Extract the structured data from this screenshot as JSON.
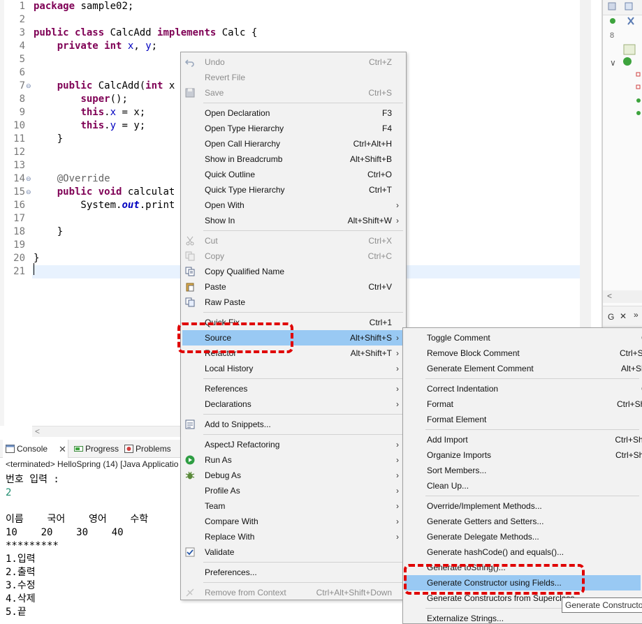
{
  "editor": {
    "line_numbers": [
      "1",
      "2",
      "3",
      "4",
      "5",
      "6",
      "7",
      "8",
      "9",
      "10",
      "11",
      "12",
      "13",
      "14",
      "15",
      "16",
      "17",
      "18",
      "19",
      "20",
      "21"
    ],
    "lines": [
      [
        {
          "t": "package",
          "c": "kw"
        },
        {
          "t": " sample02;"
        }
      ],
      [],
      [
        {
          "t": "public",
          "c": "kw"
        },
        {
          "t": " "
        },
        {
          "t": "class",
          "c": "kw"
        },
        {
          "t": " CalcAdd "
        },
        {
          "t": "implements",
          "c": "kw"
        },
        {
          "t": " Calc {"
        }
      ],
      [
        {
          "t": "    "
        },
        {
          "t": "private",
          "c": "kw"
        },
        {
          "t": " "
        },
        {
          "t": "int",
          "c": "kw"
        },
        {
          "t": " "
        },
        {
          "t": "x",
          "c": "fld"
        },
        {
          "t": ", "
        },
        {
          "t": "y",
          "c": "fld"
        },
        {
          "t": ";"
        }
      ],
      [],
      [],
      [
        {
          "t": "    "
        },
        {
          "t": "public",
          "c": "kw"
        },
        {
          "t": " CalcAdd("
        },
        {
          "t": "int",
          "c": "kw"
        },
        {
          "t": " x"
        }
      ],
      [
        {
          "t": "        "
        },
        {
          "t": "super",
          "c": "kw"
        },
        {
          "t": "();"
        }
      ],
      [
        {
          "t": "        "
        },
        {
          "t": "this",
          "c": "kw"
        },
        {
          "t": "."
        },
        {
          "t": "x",
          "c": "fld"
        },
        {
          "t": " = x;"
        }
      ],
      [
        {
          "t": "        "
        },
        {
          "t": "this",
          "c": "kw"
        },
        {
          "t": "."
        },
        {
          "t": "y",
          "c": "fld"
        },
        {
          "t": " = y;"
        }
      ],
      [
        {
          "t": "    }"
        }
      ],
      [],
      [],
      [
        {
          "t": "    "
        },
        {
          "t": "@Override",
          "c": "ann"
        }
      ],
      [
        {
          "t": "    "
        },
        {
          "t": "public",
          "c": "kw"
        },
        {
          "t": " "
        },
        {
          "t": "void",
          "c": "kw"
        },
        {
          "t": " calculat"
        }
      ],
      [
        {
          "t": "        System."
        },
        {
          "t": "out",
          "c": "ital"
        },
        {
          "t": ".print"
        }
      ],
      [],
      [
        {
          "t": "    }"
        }
      ],
      [],
      [
        {
          "t": "}"
        }
      ],
      []
    ]
  },
  "console": {
    "tabs": [
      {
        "label": "Console",
        "icon": "console-icon"
      },
      {
        "label": "Progress",
        "icon": "progress-icon"
      },
      {
        "label": "Problems",
        "icon": "problems-icon"
      }
    ],
    "close_glyph": "✕",
    "terminated": "<terminated> HelloSpring (14) [Java Applicatio",
    "output": [
      {
        "text": "번호 입력 :",
        "c": ""
      },
      {
        "text": "2",
        "c": "green"
      },
      {
        "text": "",
        "c": ""
      },
      {
        "text": "이름    국어    영어    수학",
        "c": ""
      },
      {
        "text": "10    20    30    40",
        "c": ""
      },
      {
        "text": "*********",
        "c": ""
      },
      {
        "text": "1.입력",
        "c": ""
      },
      {
        "text": "2.출력",
        "c": ""
      },
      {
        "text": "3.수정",
        "c": ""
      },
      {
        "text": "4.삭제",
        "c": ""
      },
      {
        "text": "5.끝",
        "c": ""
      }
    ]
  },
  "right_panel": {
    "tab_label": "G",
    "close_glyph": "✕",
    "more_glyph": "»",
    "scroll_left": "<"
  },
  "menu": {
    "items": [
      {
        "label": "Undo",
        "shortcut": "Ctrl+Z",
        "disabled": true,
        "icon": "undo-icon",
        "name": "undo"
      },
      {
        "label": "Revert File",
        "shortcut": "",
        "disabled": true,
        "name": "revert-file"
      },
      {
        "label": "Save",
        "shortcut": "Ctrl+S",
        "disabled": true,
        "icon": "save-icon",
        "name": "save"
      },
      {
        "sep": true
      },
      {
        "label": "Open Declaration",
        "shortcut": "F3",
        "name": "open-declaration"
      },
      {
        "label": "Open Type Hierarchy",
        "shortcut": "F4",
        "name": "open-type-hierarchy"
      },
      {
        "label": "Open Call Hierarchy",
        "shortcut": "Ctrl+Alt+H",
        "name": "open-call-hierarchy"
      },
      {
        "label": "Show in Breadcrumb",
        "shortcut": "Alt+Shift+B",
        "name": "show-in-breadcrumb"
      },
      {
        "label": "Quick Outline",
        "shortcut": "Ctrl+O",
        "name": "quick-outline"
      },
      {
        "label": "Quick Type Hierarchy",
        "shortcut": "Ctrl+T",
        "name": "quick-type-hierarchy"
      },
      {
        "label": "Open With",
        "shortcut": "",
        "submenu": true,
        "name": "open-with"
      },
      {
        "label": "Show In",
        "shortcut": "Alt+Shift+W",
        "submenu": true,
        "name": "show-in"
      },
      {
        "sep": true
      },
      {
        "label": "Cut",
        "shortcut": "Ctrl+X",
        "disabled": true,
        "icon": "cut-icon",
        "name": "cut"
      },
      {
        "label": "Copy",
        "shortcut": "Ctrl+C",
        "disabled": true,
        "icon": "copy-icon",
        "name": "copy"
      },
      {
        "label": "Copy Qualified Name",
        "shortcut": "",
        "icon": "copy-qualified-icon",
        "name": "copy-qualified-name"
      },
      {
        "label": "Paste",
        "shortcut": "Ctrl+V",
        "icon": "paste-icon",
        "name": "paste"
      },
      {
        "label": "Raw Paste",
        "shortcut": "",
        "icon": "raw-paste-icon",
        "name": "raw-paste"
      },
      {
        "sep": true
      },
      {
        "label": "Quick Fix",
        "shortcut": "Ctrl+1",
        "name": "quick-fix"
      },
      {
        "label": "Source",
        "shortcut": "Alt+Shift+S",
        "submenu": true,
        "highlight": true,
        "name": "source"
      },
      {
        "label": "Refactor",
        "shortcut": "Alt+Shift+T",
        "submenu": true,
        "name": "refactor"
      },
      {
        "label": "Local History",
        "shortcut": "",
        "submenu": true,
        "name": "local-history"
      },
      {
        "sep": true
      },
      {
        "label": "References",
        "shortcut": "",
        "submenu": true,
        "name": "references"
      },
      {
        "label": "Declarations",
        "shortcut": "",
        "submenu": true,
        "name": "declarations"
      },
      {
        "sep": true
      },
      {
        "label": "Add to Snippets...",
        "shortcut": "",
        "icon": "snippets-icon",
        "name": "add-to-snippets"
      },
      {
        "sep": true
      },
      {
        "label": "AspectJ Refactoring",
        "shortcut": "",
        "submenu": true,
        "name": "aspectj-refactoring"
      },
      {
        "label": "Run As",
        "shortcut": "",
        "submenu": true,
        "icon": "run-icon",
        "name": "run-as"
      },
      {
        "label": "Debug As",
        "shortcut": "",
        "submenu": true,
        "icon": "debug-icon",
        "name": "debug-as"
      },
      {
        "label": "Profile As",
        "shortcut": "",
        "submenu": true,
        "name": "profile-as"
      },
      {
        "label": "Team",
        "shortcut": "",
        "submenu": true,
        "name": "team"
      },
      {
        "label": "Compare With",
        "shortcut": "",
        "submenu": true,
        "name": "compare-with"
      },
      {
        "label": "Replace With",
        "shortcut": "",
        "submenu": true,
        "name": "replace-with"
      },
      {
        "label": "Validate",
        "shortcut": "",
        "icon": "checkbox-checked-icon",
        "name": "validate"
      },
      {
        "sep": true
      },
      {
        "label": "Preferences...",
        "shortcut": "",
        "name": "preferences"
      },
      {
        "sep": true
      },
      {
        "label": "Remove from Context",
        "shortcut": "Ctrl+Alt+Shift+Down",
        "disabled": true,
        "icon": "remove-context-icon",
        "name": "remove-from-context"
      }
    ],
    "submenu_arrow": "›"
  },
  "submenu": {
    "items": [
      {
        "label": "Toggle Comment",
        "shortcut": "Ctrl+/",
        "name": "toggle-comment"
      },
      {
        "label": "Remove Block Comment",
        "shortcut": "Ctrl+Shift+\\",
        "name": "remove-block-comment"
      },
      {
        "label": "Generate Element Comment",
        "shortcut": "Alt+Shift+J",
        "name": "generate-element-comment"
      },
      {
        "sep": true
      },
      {
        "label": "Correct Indentation",
        "shortcut": "Ctrl+I",
        "name": "correct-indentation"
      },
      {
        "label": "Format",
        "shortcut": "Ctrl+Shift+F",
        "name": "format"
      },
      {
        "label": "Format Element",
        "shortcut": "",
        "name": "format-element"
      },
      {
        "sep": true
      },
      {
        "label": "Add Import",
        "shortcut": "Ctrl+Shift+M",
        "name": "add-import"
      },
      {
        "label": "Organize Imports",
        "shortcut": "Ctrl+Shift+O",
        "name": "organize-imports"
      },
      {
        "label": "Sort Members...",
        "shortcut": "",
        "name": "sort-members"
      },
      {
        "label": "Clean Up...",
        "shortcut": "",
        "name": "clean-up"
      },
      {
        "sep": true
      },
      {
        "label": "Override/Implement Methods...",
        "shortcut": "",
        "name": "override-implement-methods"
      },
      {
        "label": "Generate Getters and Setters...",
        "shortcut": "",
        "name": "generate-getters-setters"
      },
      {
        "label": "Generate Delegate Methods...",
        "shortcut": "",
        "name": "generate-delegate-methods"
      },
      {
        "label": "Generate hashCode() and equals()...",
        "shortcut": "",
        "name": "generate-hashcode-equals"
      },
      {
        "label": "Generate toString()...",
        "shortcut": "",
        "name": "generate-tostring"
      },
      {
        "label": "Generate Constructor using Fields...",
        "shortcut": "",
        "highlight": true,
        "name": "generate-constructor-using-fields"
      },
      {
        "label": "Generate Constructors from Superclass...",
        "shortcut": "",
        "name": "generate-constructors-from-superclass"
      },
      {
        "sep": true
      },
      {
        "label": "Externalize Strings...",
        "shortcut": "",
        "name": "externalize-strings"
      }
    ]
  },
  "tooltip": {
    "text": "Generate Constructor using Fields"
  },
  "colors": {
    "accent_highlight": "#99c9f3",
    "annotation_red": "#e00000",
    "keyword": "#7f0055",
    "field": "#0000c0"
  }
}
